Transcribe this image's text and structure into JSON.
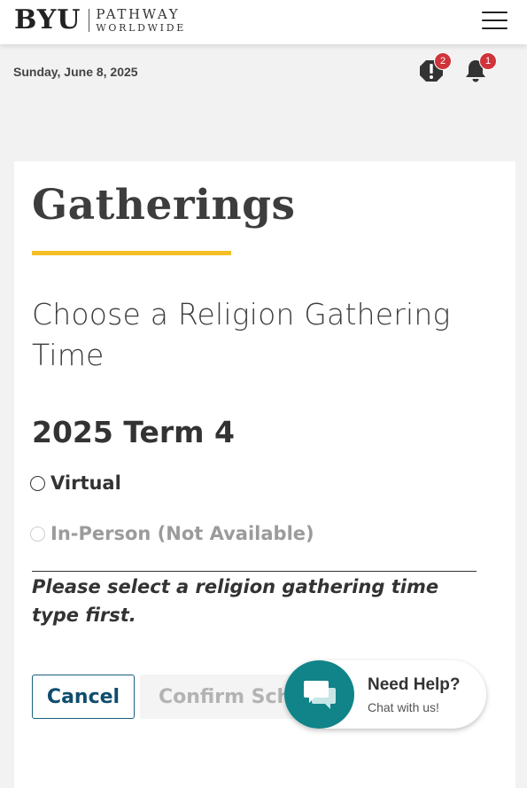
{
  "header": {
    "logo_primary": "BYU",
    "logo_line1": "PATHWAY",
    "logo_line2": "WORLDWIDE"
  },
  "status_row": {
    "date": "Sunday, June 8, 2025",
    "alerts_count": "2",
    "notifications_count": "1"
  },
  "card": {
    "title": "Gatherings",
    "subtitle": "Choose a Religion Gathering Time",
    "term": "2025 Term 4",
    "options": [
      {
        "label": "Virtual",
        "enabled": true,
        "selected": false
      },
      {
        "label": "In-Person (Not Available)",
        "enabled": false,
        "selected": false
      }
    ],
    "message": "Please select a religion gathering time type first.",
    "cancel_label": "Cancel",
    "confirm_label": "Confirm Schedule"
  },
  "chat": {
    "title": "Need Help?",
    "subtitle": "Chat with us!"
  },
  "colors": {
    "accent_yellow": "#f5be25",
    "primary_blue": "#0f4d6e",
    "chat_teal": "#108488",
    "badge_red": "#d0343b"
  },
  "icons": {
    "menu": "hamburger-menu-icon",
    "alerts": "alert-exclamation-icon",
    "notifications": "bell-icon",
    "chat": "chat-bubbles-icon"
  }
}
